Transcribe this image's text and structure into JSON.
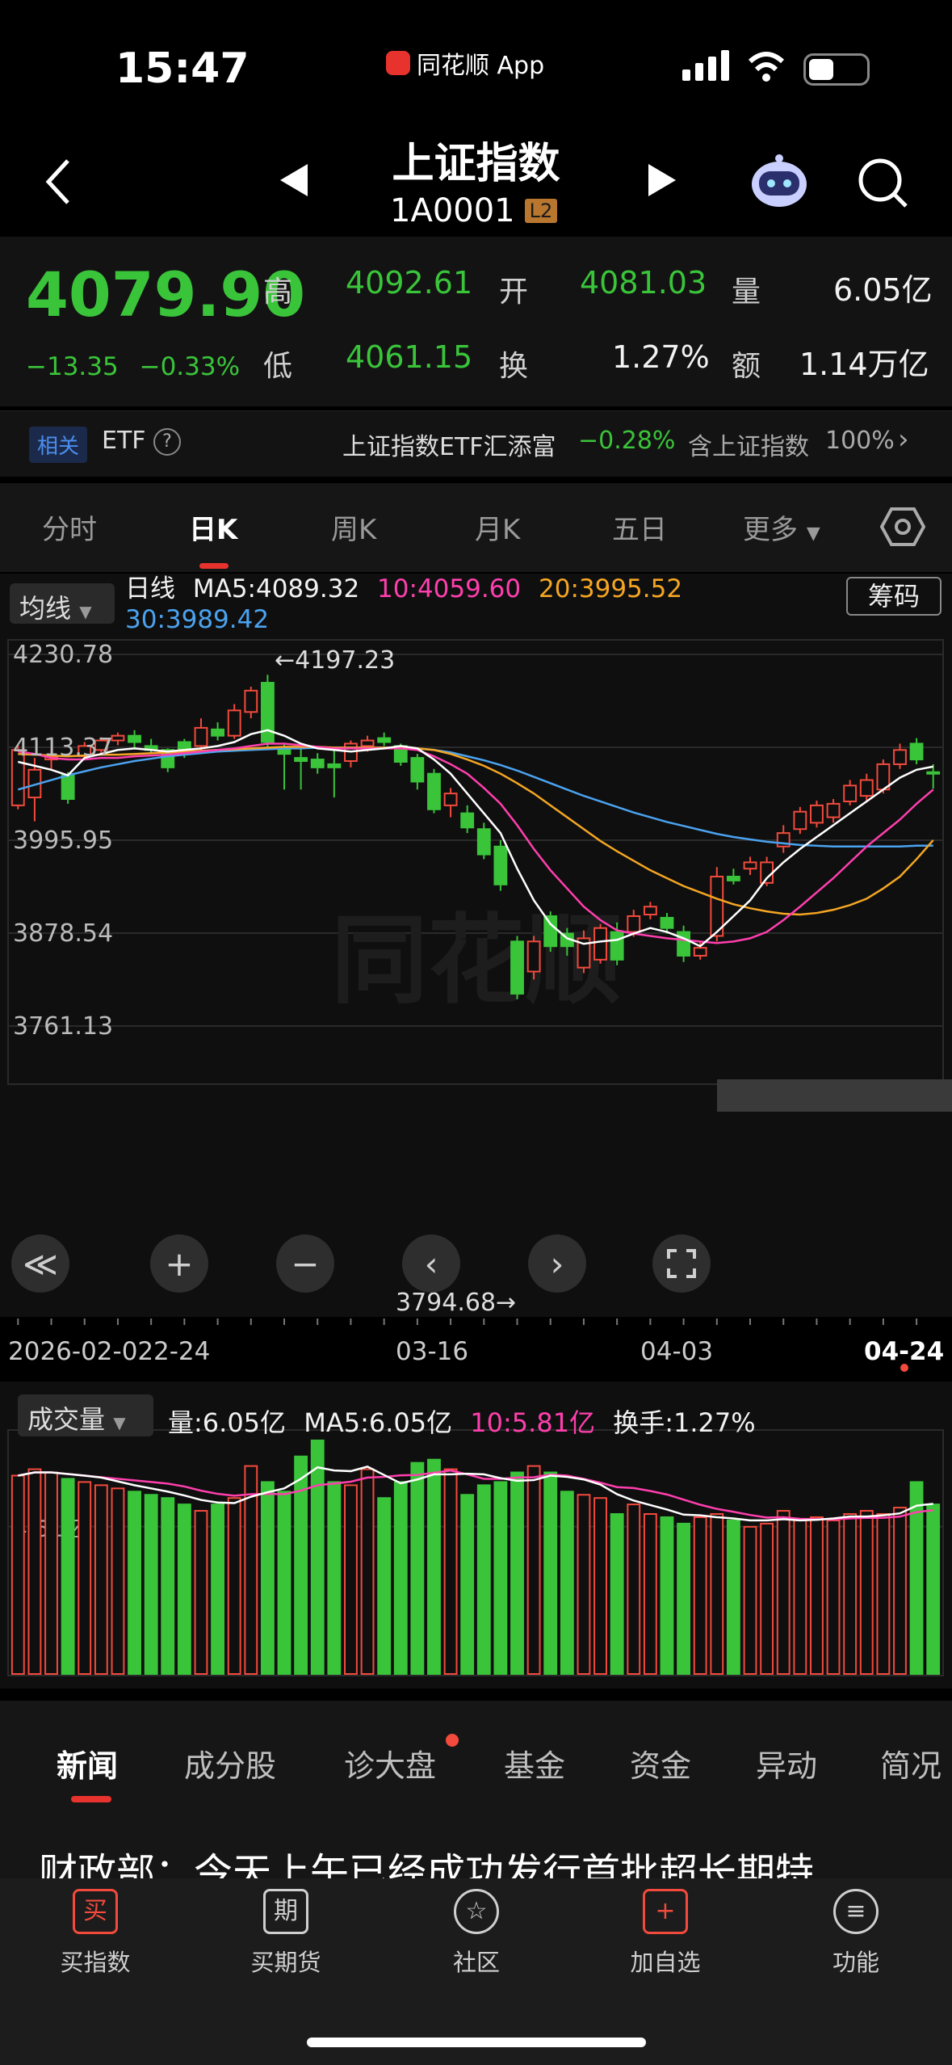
{
  "status": {
    "time": "15:47",
    "app": "同花顺 App"
  },
  "header": {
    "title": "上证指数",
    "code": "1A0001",
    "level": "L2"
  },
  "quote": {
    "price": "4079.90",
    "change": "−13.35",
    "change_pct": "−0.33%",
    "high_label": "高",
    "high": "4092.61",
    "low_label": "低",
    "low": "4061.15",
    "open_label": "开",
    "open": "4081.03",
    "turnover_label": "换",
    "turnover": "1.27%",
    "volume_label": "量",
    "volume": "6.05亿",
    "amount_label": "额",
    "amount": "1.14万亿"
  },
  "etf": {
    "related": "相关",
    "etf": "ETF",
    "name": "上证指数ETF汇添富",
    "pct": "−0.28%",
    "holding": "含上证指数",
    "holding_pct": "100%"
  },
  "tabs": [
    "分时",
    "日K",
    "周K",
    "月K",
    "五日",
    "更多"
  ],
  "active_tab": "日K",
  "ma": {
    "selector": "均线",
    "label": "日线",
    "ma5": "MA5:4089.32",
    "ma10": "10:4059.60",
    "ma20": "20:3995.52",
    "ma30": "30:3989.42",
    "chouma": "筹码"
  },
  "colors": {
    "up": "#f24a3c",
    "down": "#3ac43a",
    "ma5": "#ffffff",
    "ma10": "#ff3fae",
    "ma20": "#f5a623",
    "ma30": "#4ba3f0"
  },
  "chart_data": {
    "type": "candlestick",
    "y_ticks": [
      "4230.78",
      "4113.37",
      "3995.95",
      "3878.54",
      "3761.13"
    ],
    "ylim": [
      3761.13,
      4230.78
    ],
    "x_labels": [
      "2026-02-02",
      "2-24",
      "03-16",
      "04-03",
      "04-24"
    ],
    "annotations": {
      "high": "←4197.23",
      "low": "3794.68→"
    },
    "candles": [
      {
        "o": 4040,
        "c": 4110,
        "h": 4118,
        "l": 4035
      },
      {
        "o": 4050,
        "c": 4085,
        "h": 4100,
        "l": 4020
      },
      {
        "o": 4098,
        "c": 4101,
        "h": 4112,
        "l": 4084
      },
      {
        "o": 4078,
        "c": 4048,
        "h": 4082,
        "l": 4042
      },
      {
        "o": 4102,
        "c": 4115,
        "h": 4120,
        "l": 4098
      },
      {
        "o": 4110,
        "c": 4122,
        "h": 4126,
        "l": 4105
      },
      {
        "o": 4122,
        "c": 4128,
        "h": 4132,
        "l": 4116
      },
      {
        "o": 4128,
        "c": 4120,
        "h": 4135,
        "l": 4112
      },
      {
        "o": 4115,
        "c": 4110,
        "h": 4124,
        "l": 4106
      },
      {
        "o": 4110,
        "c": 4088,
        "h": 4112,
        "l": 4082
      },
      {
        "o": 4120,
        "c": 4106,
        "h": 4124,
        "l": 4100
      },
      {
        "o": 4115,
        "c": 4138,
        "h": 4150,
        "l": 4110
      },
      {
        "o": 4136,
        "c": 4128,
        "h": 4145,
        "l": 4122
      },
      {
        "o": 4128,
        "c": 4160,
        "h": 4168,
        "l": 4124
      },
      {
        "o": 4158,
        "c": 4185,
        "h": 4190,
        "l": 4150
      },
      {
        "o": 4195,
        "c": 4120,
        "h": 4205,
        "l": 4112
      },
      {
        "o": 4112,
        "c": 4105,
        "h": 4118,
        "l": 4060
      },
      {
        "o": 4100,
        "c": 4096,
        "h": 4115,
        "l": 4060
      },
      {
        "o": 4098,
        "c": 4088,
        "h": 4106,
        "l": 4080
      },
      {
        "o": 4092,
        "c": 4088,
        "h": 4112,
        "l": 4050
      },
      {
        "o": 4096,
        "c": 4118,
        "h": 4122,
        "l": 4088
      },
      {
        "o": 4115,
        "c": 4122,
        "h": 4128,
        "l": 4108
      },
      {
        "o": 4125,
        "c": 4120,
        "h": 4132,
        "l": 4115
      },
      {
        "o": 4115,
        "c": 4095,
        "h": 4118,
        "l": 4090
      },
      {
        "o": 4100,
        "c": 4070,
        "h": 4105,
        "l": 4060
      },
      {
        "o": 4080,
        "c": 4035,
        "h": 4086,
        "l": 4030
      },
      {
        "o": 4040,
        "c": 4055,
        "h": 4062,
        "l": 4025
      },
      {
        "o": 4030,
        "c": 4012,
        "h": 4040,
        "l": 4005
      },
      {
        "o": 4010,
        "c": 3978,
        "h": 4018,
        "l": 3972
      },
      {
        "o": 3988,
        "c": 3940,
        "h": 3996,
        "l": 3932
      },
      {
        "o": 3868,
        "c": 3802,
        "h": 3875,
        "l": 3795
      },
      {
        "o": 3830,
        "c": 3868,
        "h": 3875,
        "l": 3820
      },
      {
        "o": 3900,
        "c": 3862,
        "h": 3906,
        "l": 3855
      },
      {
        "o": 3878,
        "c": 3862,
        "h": 3885,
        "l": 3850
      },
      {
        "o": 3835,
        "c": 3872,
        "h": 3882,
        "l": 3828
      },
      {
        "o": 3845,
        "c": 3885,
        "h": 3890,
        "l": 3840
      },
      {
        "o": 3880,
        "c": 3845,
        "h": 3892,
        "l": 3838
      },
      {
        "o": 3880,
        "c": 3900,
        "h": 3908,
        "l": 3874
      },
      {
        "o": 3902,
        "c": 3912,
        "h": 3918,
        "l": 3896
      },
      {
        "o": 3898,
        "c": 3885,
        "h": 3904,
        "l": 3878
      },
      {
        "o": 3880,
        "c": 3850,
        "h": 3888,
        "l": 3842
      },
      {
        "o": 3850,
        "c": 3860,
        "h": 3868,
        "l": 3845
      },
      {
        "o": 3875,
        "c": 3950,
        "h": 3962,
        "l": 3868
      },
      {
        "o": 3950,
        "c": 3945,
        "h": 3960,
        "l": 3940
      },
      {
        "o": 3960,
        "c": 3968,
        "h": 3975,
        "l": 3952
      },
      {
        "o": 3942,
        "c": 3968,
        "h": 3975,
        "l": 3938
      },
      {
        "o": 3988,
        "c": 4005,
        "h": 4015,
        "l": 3980
      },
      {
        "o": 4010,
        "c": 4032,
        "h": 4038,
        "l": 4004
      },
      {
        "o": 4018,
        "c": 4040,
        "h": 4046,
        "l": 4012
      },
      {
        "o": 4025,
        "c": 4042,
        "h": 4048,
        "l": 4018
      },
      {
        "o": 4045,
        "c": 4065,
        "h": 4072,
        "l": 4040
      },
      {
        "o": 4052,
        "c": 4072,
        "h": 4080,
        "l": 4046
      },
      {
        "o": 4060,
        "c": 4092,
        "h": 4098,
        "l": 4055
      },
      {
        "o": 4092,
        "c": 4110,
        "h": 4118,
        "l": 4086
      },
      {
        "o": 4118,
        "c": 4098,
        "h": 4125,
        "l": 4092
      },
      {
        "o": 4082,
        "c": 4080,
        "h": 4092,
        "l": 4061
      }
    ],
    "ma5": [
      4095,
      4090,
      4085,
      4078,
      4100,
      4105,
      4110,
      4112,
      4110,
      4108,
      4110,
      4112,
      4115,
      4120,
      4130,
      4135,
      4128,
      4118,
      4112,
      4110,
      4108,
      4110,
      4112,
      4115,
      4112,
      4098,
      4080,
      4055,
      4030,
      4005,
      3960,
      3920,
      3890,
      3872,
      3865,
      3868,
      3870,
      3878,
      3885,
      3880,
      3872,
      3862,
      3880,
      3900,
      3920,
      3948,
      3968,
      3985,
      4000,
      4015,
      4030,
      4045,
      4060,
      4075,
      4085,
      4089
    ],
    "ma10": [
      4108,
      4105,
      4100,
      4098,
      4098,
      4100,
      4100,
      4102,
      4103,
      4104,
      4106,
      4108,
      4110,
      4112,
      4115,
      4118,
      4118,
      4116,
      4114,
      4112,
      4112,
      4112,
      4112,
      4112,
      4110,
      4102,
      4092,
      4080,
      4062,
      4042,
      4015,
      3985,
      3958,
      3935,
      3912,
      3895,
      3882,
      3878,
      3875,
      3872,
      3870,
      3868,
      3866,
      3868,
      3872,
      3880,
      3895,
      3912,
      3930,
      3948,
      3968,
      3988,
      4005,
      4022,
      4042,
      4060
    ],
    "ma20": [
      4105,
      4104,
      4103,
      4102,
      4103,
      4104,
      4104,
      4105,
      4106,
      4107,
      4108,
      4109,
      4110,
      4111,
      4112,
      4113,
      4114,
      4114,
      4114,
      4113,
      4113,
      4113,
      4113,
      4113,
      4112,
      4110,
      4105,
      4098,
      4090,
      4080,
      4068,
      4055,
      4040,
      4025,
      4010,
      3995,
      3982,
      3970,
      3958,
      3948,
      3938,
      3930,
      3922,
      3915,
      3910,
      3906,
      3903,
      3902,
      3904,
      3908,
      3914,
      3922,
      3935,
      3950,
      3972,
      3996
    ],
    "ma30": [
      4060,
      4066,
      4072,
      4078,
      4083,
      4088,
      4092,
      4096,
      4099,
      4102,
      4104,
      4106,
      4108,
      4109,
      4110,
      4111,
      4112,
      4112,
      4113,
      4113,
      4113,
      4113,
      4113,
      4113,
      4112,
      4110,
      4107,
      4102,
      4097,
      4091,
      4084,
      4076,
      4068,
      4060,
      4052,
      4045,
      4038,
      4031,
      4025,
      4019,
      4014,
      4009,
      4004,
      4000,
      3997,
      3994,
      3992,
      3990,
      3989,
      3988,
      3988,
      3988,
      3988,
      3988,
      3989,
      3989
    ]
  },
  "volume": {
    "selector": "成交量",
    "vol": "量:6.05亿",
    "ma5": "MA5:6.05亿",
    "ma10": "10:5.81亿",
    "turnover": "换手:1.27%",
    "y_tick": "4.61亿",
    "values": [
      6.2,
      6.4,
      6.3,
      6.1,
      6.0,
      5.9,
      5.8,
      5.7,
      5.6,
      5.5,
      5.3,
      5.1,
      5.3,
      5.5,
      6.5,
      6.0,
      5.7,
      6.8,
      7.3,
      6.0,
      5.9,
      6.4,
      5.5,
      6.0,
      6.6,
      6.7,
      6.4,
      5.6,
      5.9,
      6.0,
      6.3,
      6.5,
      6.3,
      5.7,
      5.6,
      5.5,
      5.0,
      5.3,
      5.0,
      4.9,
      4.7,
      4.9,
      5.0,
      4.8,
      4.6,
      4.7,
      5.1,
      4.8,
      4.9,
      4.8,
      5.0,
      5.1,
      5.0,
      5.2,
      6.0,
      5.3
    ]
  },
  "chart_controls": {
    "rewind": "≪",
    "plus": "+",
    "minus": "−",
    "prev": "‹",
    "next": "›"
  },
  "news_tabs": [
    "新闻",
    "成分股",
    "诊大盘",
    "基金",
    "资金",
    "异动",
    "简况"
  ],
  "headline": "财政部：今天上午已经成功发行首批超长期特",
  "bottom_nav": [
    {
      "icon": "买",
      "label": "买指数"
    },
    {
      "icon": "期",
      "label": "买期货"
    },
    {
      "icon": "☆",
      "label": "社区"
    },
    {
      "icon": "+",
      "label": "加自选"
    },
    {
      "icon": "≡",
      "label": "功能"
    }
  ]
}
